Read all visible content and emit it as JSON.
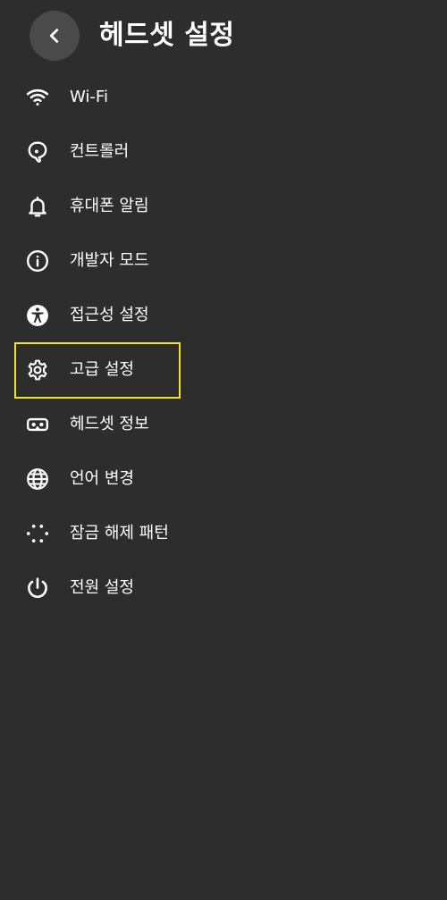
{
  "header": {
    "title": "헤드셋 설정",
    "back_icon": "chevron-left-icon"
  },
  "menu": {
    "items": [
      {
        "label": "Wi-Fi",
        "icon": "wifi-icon"
      },
      {
        "label": "컨트롤러",
        "icon": "controller-icon"
      },
      {
        "label": "휴대폰 알림",
        "icon": "bell-icon"
      },
      {
        "label": "개발자 모드",
        "icon": "info-icon"
      },
      {
        "label": "접근성 설정",
        "icon": "accessibility-icon"
      },
      {
        "label": "고급 설정",
        "icon": "gear-icon",
        "selected": true
      },
      {
        "label": "헤드셋 정보",
        "icon": "headset-icon"
      },
      {
        "label": "언어 변경",
        "icon": "globe-icon"
      },
      {
        "label": "잠금 해제 패턴",
        "icon": "pattern-dots-icon"
      },
      {
        "label": "전원 설정",
        "icon": "power-icon"
      }
    ]
  },
  "colors": {
    "background": "#2d2d2d",
    "back_button_bg": "#4a4a4a",
    "text": "#ffffff",
    "focus_outline": "#f3e71a"
  }
}
